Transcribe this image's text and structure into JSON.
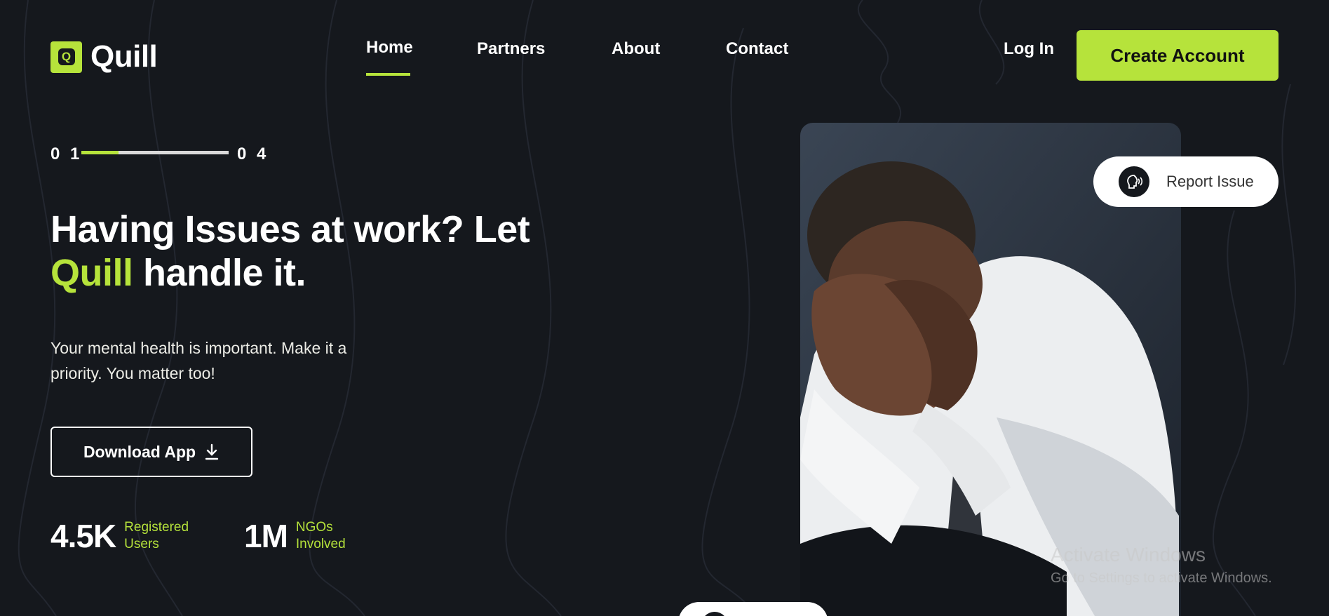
{
  "brand": {
    "logo_letter": "Q",
    "name": "Quill"
  },
  "nav": {
    "links": [
      "Home",
      "Partners",
      "About",
      "Contact"
    ],
    "active": "Home",
    "login": "Log In",
    "create_account": "Create Account"
  },
  "slider": {
    "current": "0 1",
    "total": "0 4",
    "progress": 0.25
  },
  "hero": {
    "headline_1": "Having Issues at work? Let",
    "headline_accent": "Quill",
    "headline_2": " handle it.",
    "subtext": "Your mental health is important. Make it a priority. You matter too!",
    "download_label": "Download App"
  },
  "stats": [
    {
      "value": "4.5K",
      "label_1": "Registered",
      "label_2": "Users"
    },
    {
      "value": "1M",
      "label_1": "NGOs",
      "label_2": "Involved"
    }
  ],
  "report": {
    "label": "Report Issue",
    "icon": "head-speaking-icon"
  },
  "watermark": {
    "title": "Activate Windows",
    "subtitle": "Go to Settings to activate Windows."
  },
  "colors": {
    "accent": "#b6e33b",
    "background": "#15181d"
  }
}
